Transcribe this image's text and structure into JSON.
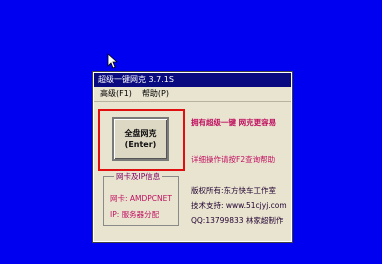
{
  "window": {
    "title": "超级一键网克 3.7.1S",
    "menu": [
      "高级(F1)",
      "帮助(P)"
    ]
  },
  "main_button": {
    "line1": "全盘网克",
    "line2": "(Enter)"
  },
  "slogan": "拥有超级一键 网克更容易",
  "help_tip": "详细操作请按F2查询帮助",
  "nic_group": {
    "title": "网卡及IP信息",
    "nic": "网卡: AMDPCNET",
    "ip": "IP: 服务器分配"
  },
  "info": {
    "copyright": "版权所有:东方快车工作室",
    "support": "技术支持: www.51cjyj.com",
    "qq": "QQ:13799833 林家超制作"
  },
  "colors": {
    "desktop": "#0000f0",
    "title_bar": "#0a0a80",
    "highlight_frame": "#e01010",
    "accent_text": "#c01060"
  }
}
